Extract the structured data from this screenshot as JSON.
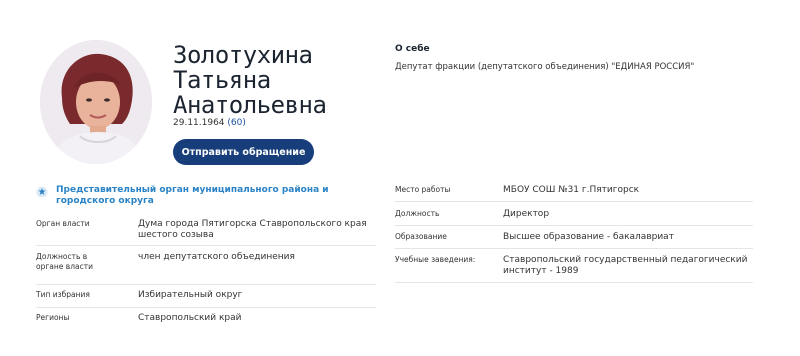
{
  "profile": {
    "name_lines": [
      "Золотухина",
      "Татьяна",
      "Анатольевна"
    ],
    "birth_date": "29.11.1964",
    "age": "(60)",
    "appeal_button": "Отправить обращение"
  },
  "about": {
    "title": "О себе",
    "text": "Депутат фракции (депутатского объединения) \"ЕДИНАЯ РОССИЯ\""
  },
  "organ": {
    "title": "Представительный орган муниципального района и городского округа",
    "rows": [
      {
        "label": "Орган власти",
        "value": "Дума города Пятигорска Ставропольского края шестого созыва"
      },
      {
        "label": "Должность в органе власти",
        "value": "член депутатского объединения"
      },
      {
        "label": "Тип избрания",
        "value": "Избирательный округ"
      },
      {
        "label": "Регионы",
        "value": "Ставропольский край"
      }
    ]
  },
  "work": {
    "rows": [
      {
        "label": "Место работы",
        "value": "МБОУ СОШ №31 г.Пятигорск"
      },
      {
        "label": "Должность",
        "value": "Директор"
      },
      {
        "label": "Образование",
        "value": "Высшее образование - бакалавриат"
      },
      {
        "label": "Учебные заведения:",
        "value": "Ставропольский государственный педагогический институт - 1989"
      }
    ]
  },
  "colors": {
    "accent_button": "#173d7a",
    "link_blue": "#2a83c6"
  }
}
